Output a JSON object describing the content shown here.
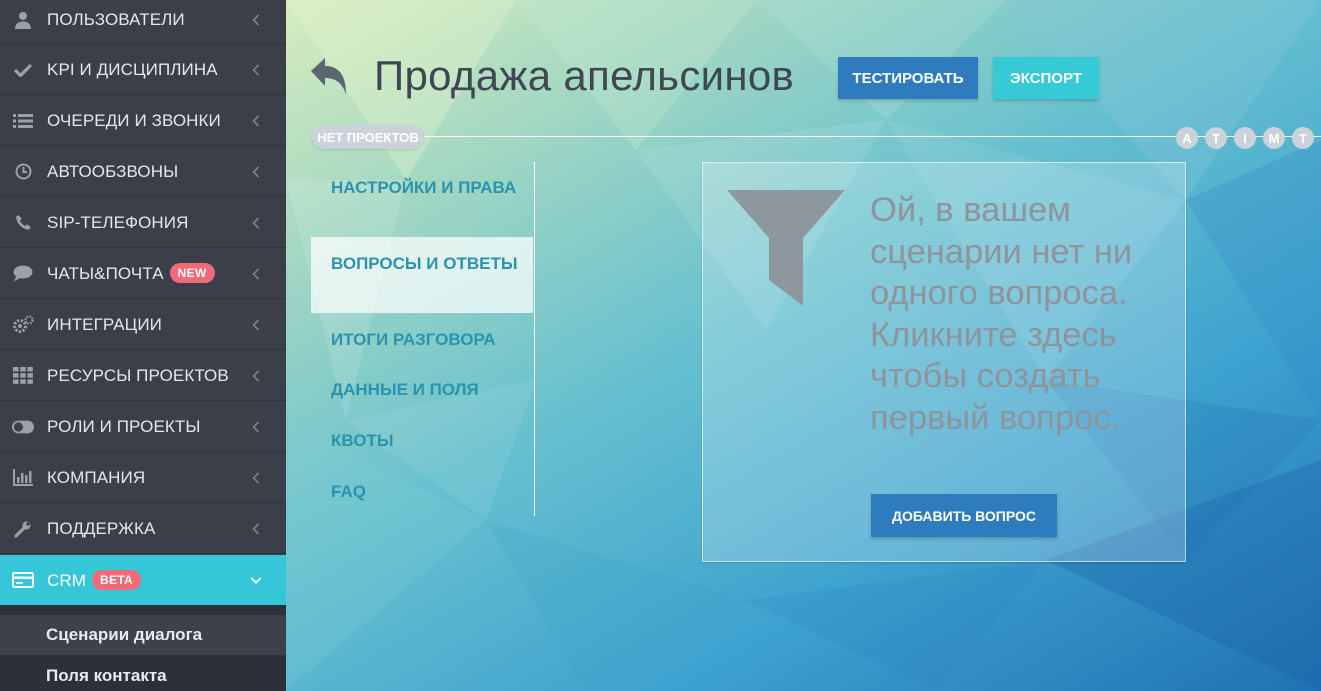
{
  "sidebar": {
    "items": [
      {
        "label": "ПОЛЬЗОВАТЕЛИ",
        "icon": "user-icon"
      },
      {
        "label": "KPI И ДИСЦИПЛИНА",
        "icon": "check-icon"
      },
      {
        "label": "ОЧЕРЕДИ И ЗВОНКИ",
        "icon": "list-icon"
      },
      {
        "label": "АВТООБЗВОНЫ",
        "icon": "clock-icon"
      },
      {
        "label": "SIP-ТЕЛЕФОНИЯ",
        "icon": "phone-icon"
      },
      {
        "label": "ЧАТЫ&ПОЧТА",
        "icon": "chat-icon",
        "badge": "NEW"
      },
      {
        "label": "ИНТЕГРАЦИИ",
        "icon": "gears-icon"
      },
      {
        "label": "РЕСУРСЫ ПРОЕКТОВ",
        "icon": "grid-icon"
      },
      {
        "label": "РОЛИ И ПРОЕКТЫ",
        "icon": "toggle-icon"
      },
      {
        "label": "КОМПАНИЯ",
        "icon": "bar-chart-icon"
      },
      {
        "label": "ПОДДЕРЖКА",
        "icon": "wrench-icon"
      },
      {
        "label": "CRM",
        "icon": "credit-card-icon",
        "badge": "BETA",
        "active": true
      }
    ],
    "submenu": [
      {
        "label": "Сценарии диалога",
        "current": true
      },
      {
        "label": "Поля контакта"
      }
    ]
  },
  "header": {
    "title": "Продажа апельсинов",
    "test_label": "ТЕСТИРОВАТЬ",
    "export_label": "ЭКСПОРТ"
  },
  "timeline": {
    "projects_label": "НЕТ ПРОЕКТОВ",
    "markers": [
      "A",
      "T",
      "I",
      "M",
      "T"
    ]
  },
  "subnav": [
    {
      "label": "НАСТРОЙКИ И ПРАВА"
    },
    {
      "label": "ВОПРОСЫ И ОТВЕТЫ",
      "selected": true
    },
    {
      "label": "ИТОГИ РАЗГОВОРА"
    },
    {
      "label": "ДАННЫЕ И ПОЛЯ"
    },
    {
      "label": "КВОТЫ"
    },
    {
      "label": "FAQ"
    }
  ],
  "empty_state": {
    "message": "Ой, в вашем сценарии нет ни одного вопроса. Кликните здесь чтобы создать первый вопрос.",
    "add_label": "ДОБАВИТЬ ВОПРОС",
    "icon": "funnel-icon"
  },
  "colors": {
    "sidebar_bg": "#3a3f49",
    "active_item": "#35c7d8",
    "badge": "#f26a78",
    "primary_button": "#2e7bbe",
    "export_button": "#36c9d6",
    "subnav_text": "#2a93ad"
  }
}
